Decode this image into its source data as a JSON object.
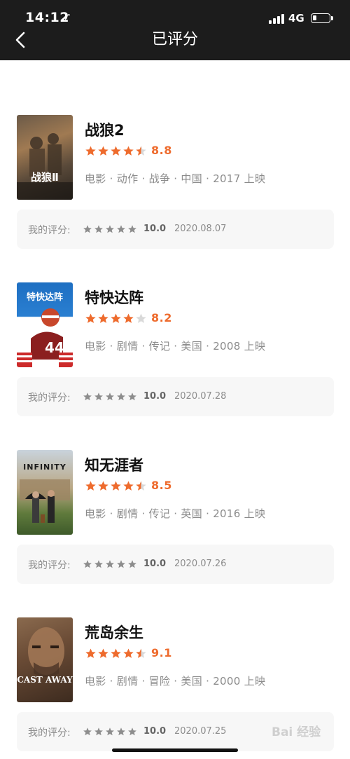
{
  "status_bar": {
    "time": "14:12",
    "location_glyph": "➹",
    "network": "4G",
    "battery_icon": "battery-low-icon"
  },
  "nav": {
    "back_icon": "chevron-left-icon",
    "title": "已评分"
  },
  "colors": {
    "accent": "#ee6b2d",
    "topbar_bg": "#1c1c1c",
    "star_gray": "#8d8d8d"
  },
  "items": [
    {
      "title": "战狼2",
      "stars": 4.5,
      "score": "8.8",
      "meta": "电影 · 动作 · 战争 · 中国 · 2017 上映",
      "my_label": "我的评分:",
      "my_stars": 5,
      "my_score": "10.0",
      "my_date": "2020.08.07",
      "poster_text": "战狼Ⅱ"
    },
    {
      "title": "特快达阵",
      "stars": 4,
      "score": "8.2",
      "meta": "电影 · 剧情 · 传记 · 美国 · 2008 上映",
      "my_label": "我的评分:",
      "my_stars": 5,
      "my_score": "10.0",
      "my_date": "2020.07.28",
      "poster_text": "特快达阵"
    },
    {
      "title": "知无涯者",
      "stars": 4.5,
      "score": "8.5",
      "meta": "电影 · 剧情 · 传记 · 英国 · 2016 上映",
      "my_label": "我的评分:",
      "my_stars": 5,
      "my_score": "10.0",
      "my_date": "2020.07.26",
      "poster_text": "INFINITY"
    },
    {
      "title": "荒岛余生",
      "stars": 4.5,
      "score": "9.1",
      "meta": "电影 · 剧情 · 冒险 · 美国 · 2000 上映",
      "my_label": "我的评分:",
      "my_stars": 5,
      "my_score": "10.0",
      "my_date": "2020.07.25",
      "poster_text": "CAST AWAY"
    }
  ],
  "watermark": "Bai 经验"
}
